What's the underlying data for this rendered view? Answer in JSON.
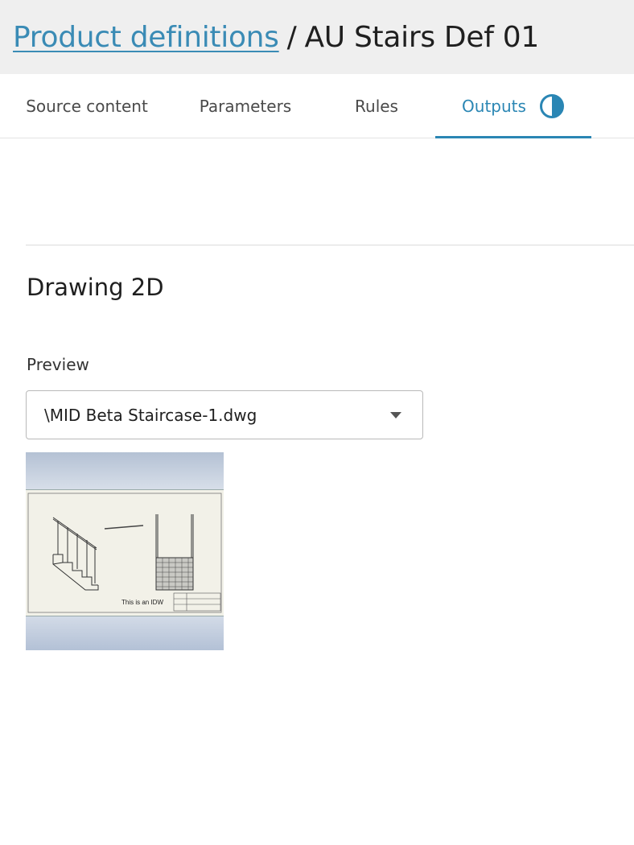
{
  "breadcrumb": {
    "parent": "Product definitions",
    "separator": "/",
    "current": "AU Stairs Def 01"
  },
  "tabs": [
    {
      "label": "Source content",
      "active": false
    },
    {
      "label": "Parameters",
      "active": false
    },
    {
      "label": "Rules",
      "active": false
    },
    {
      "label": "Outputs",
      "active": true,
      "icon": "half-circle-status-icon"
    }
  ],
  "section": {
    "title": "Drawing 2D",
    "preview_label": "Preview",
    "selected_file": "\\MID Beta Staircase-1.dwg"
  },
  "preview_image": {
    "caption": "This is an IDW"
  },
  "colors": {
    "accent": "#2a86b4",
    "link": "#3a8bb5",
    "header_bg": "#efefef"
  }
}
